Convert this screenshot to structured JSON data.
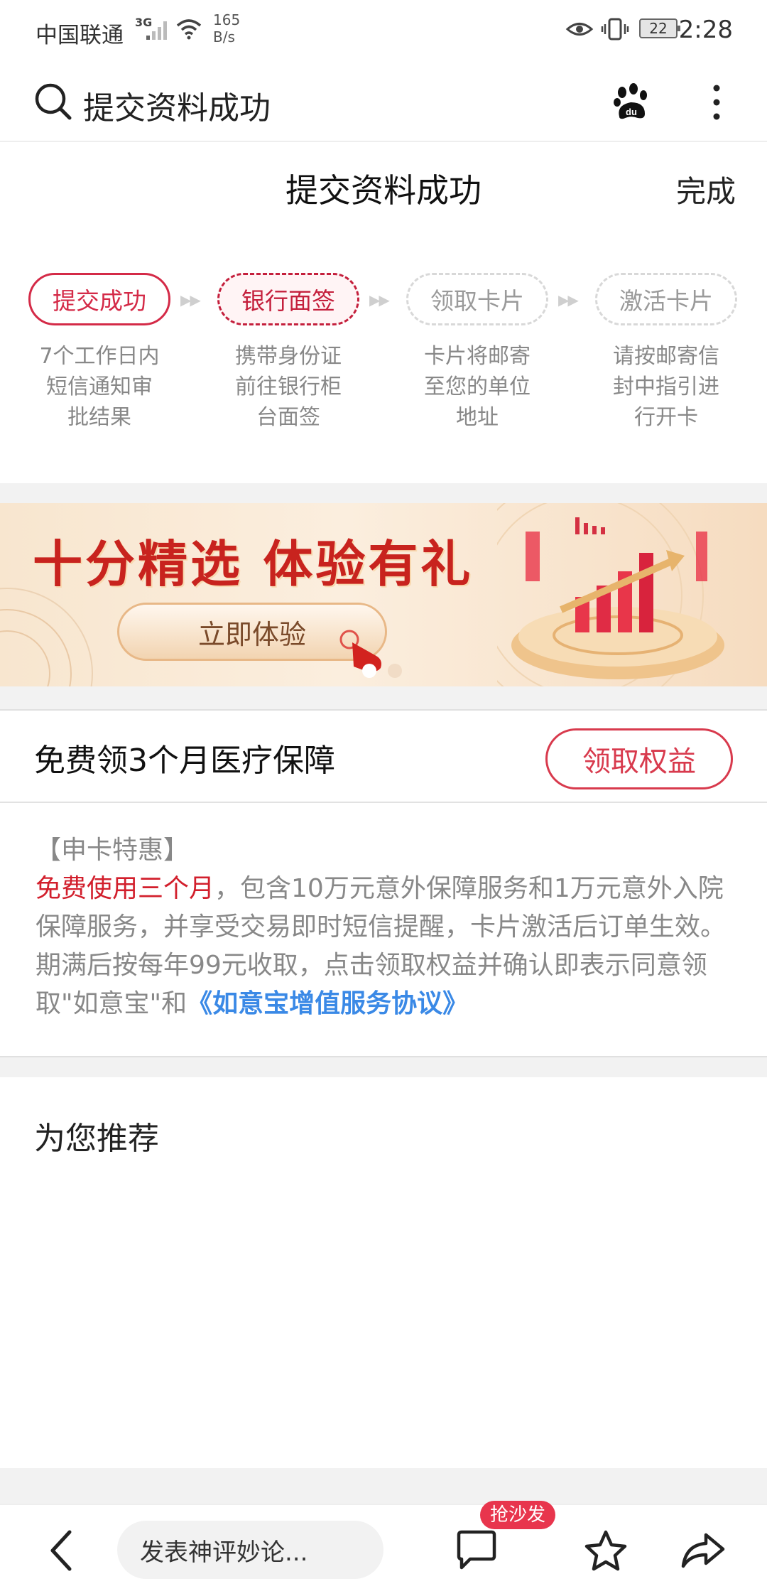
{
  "status_bar": {
    "carrier": "中国联通",
    "network": "3G",
    "speed_value": "165",
    "speed_unit": "B/s",
    "battery": "22",
    "time": "2:28"
  },
  "browser_bar": {
    "title": "提交资料成功"
  },
  "header": {
    "title": "提交资料成功",
    "done_label": "完成"
  },
  "steps": [
    {
      "label": "提交成功",
      "desc": [
        "7个工作日内",
        "短信通知审",
        "批结果"
      ]
    },
    {
      "label": "银行面签",
      "desc": [
        "携带身份证",
        "前往银行柜",
        "台面签"
      ]
    },
    {
      "label": "领取卡片",
      "desc": [
        "卡片将邮寄",
        "至您的单位",
        "地址"
      ]
    },
    {
      "label": "激活卡片",
      "desc": [
        "请按邮寄信",
        "封中指引进",
        "行开卡"
      ]
    }
  ],
  "banner": {
    "title": "十分精选 体验有礼",
    "button_label": "立即体验"
  },
  "benefit": {
    "title": "免费领3个月医疗保障",
    "button_label": "领取权益"
  },
  "promo": {
    "heading": "【申卡特惠】",
    "highlight": "免费使用三个月",
    "body": "，包含10万元意外保障服务和1万元意外入院保障服务，并享受交易即时短信提醒，卡片激活后订单生效。期满后按每年99元收取，点击领取权益并确认即表示同意领取\"如意宝\"和",
    "link": "《如意宝增值服务协议》"
  },
  "recommend": {
    "title": "为您推荐"
  },
  "bottom_bar": {
    "comment_placeholder": "发表神评妙论...",
    "badge": "抢沙发"
  },
  "colors": {
    "accent_red": "#d42a47",
    "link_blue": "#3a89e6"
  }
}
